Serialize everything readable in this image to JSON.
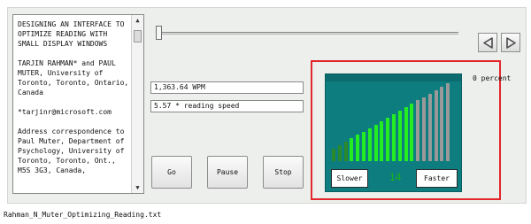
{
  "text_area": {
    "paragraphs": [
      "DESIGNING AN INTERFACE TO\nOPTIMIZE READING WITH\nSMALL DISPLAY WINDOWS",
      "TARJIN RAHMAN* and PAUL\nMUTER, University of\nToronto, Toronto, Ontario,\nCanada",
      "*tarjinr@microsoft.com",
      "Address correspondence to\nPaul Muter, Department of\nPsychology, University of\nToronto, Toronto, Ont.,\nM5S 3G3, Canada,"
    ]
  },
  "readouts": {
    "wpm": "1,363.64 WPM",
    "speed": "5.57 * reading speed"
  },
  "buttons": {
    "go": "Go",
    "pause": "Pause",
    "stop": "Stop"
  },
  "speed_control": {
    "slower_label": "Slower",
    "faster_label": "Faster",
    "speed_level": "14",
    "bars_total": 20,
    "bars_lit": 14,
    "colors": {
      "lit": "#22ee22",
      "lit_dim": "#2a8a2a",
      "unlit": "#999999",
      "meter_bg": "#0e7d80",
      "frame": "#e3262b",
      "level_text": "#19b319"
    }
  },
  "progress": {
    "text": "0 percent",
    "value": 0
  },
  "status_bar": {
    "filename": "Rahman_N_Muter_Optimizing_Reading.txt"
  },
  "icons": {
    "back": "triangle-left-icon",
    "forward": "triangle-right-icon",
    "scroll_up": "scroll-up-arrow-icon",
    "scroll_down": "scroll-down-arrow-icon"
  }
}
